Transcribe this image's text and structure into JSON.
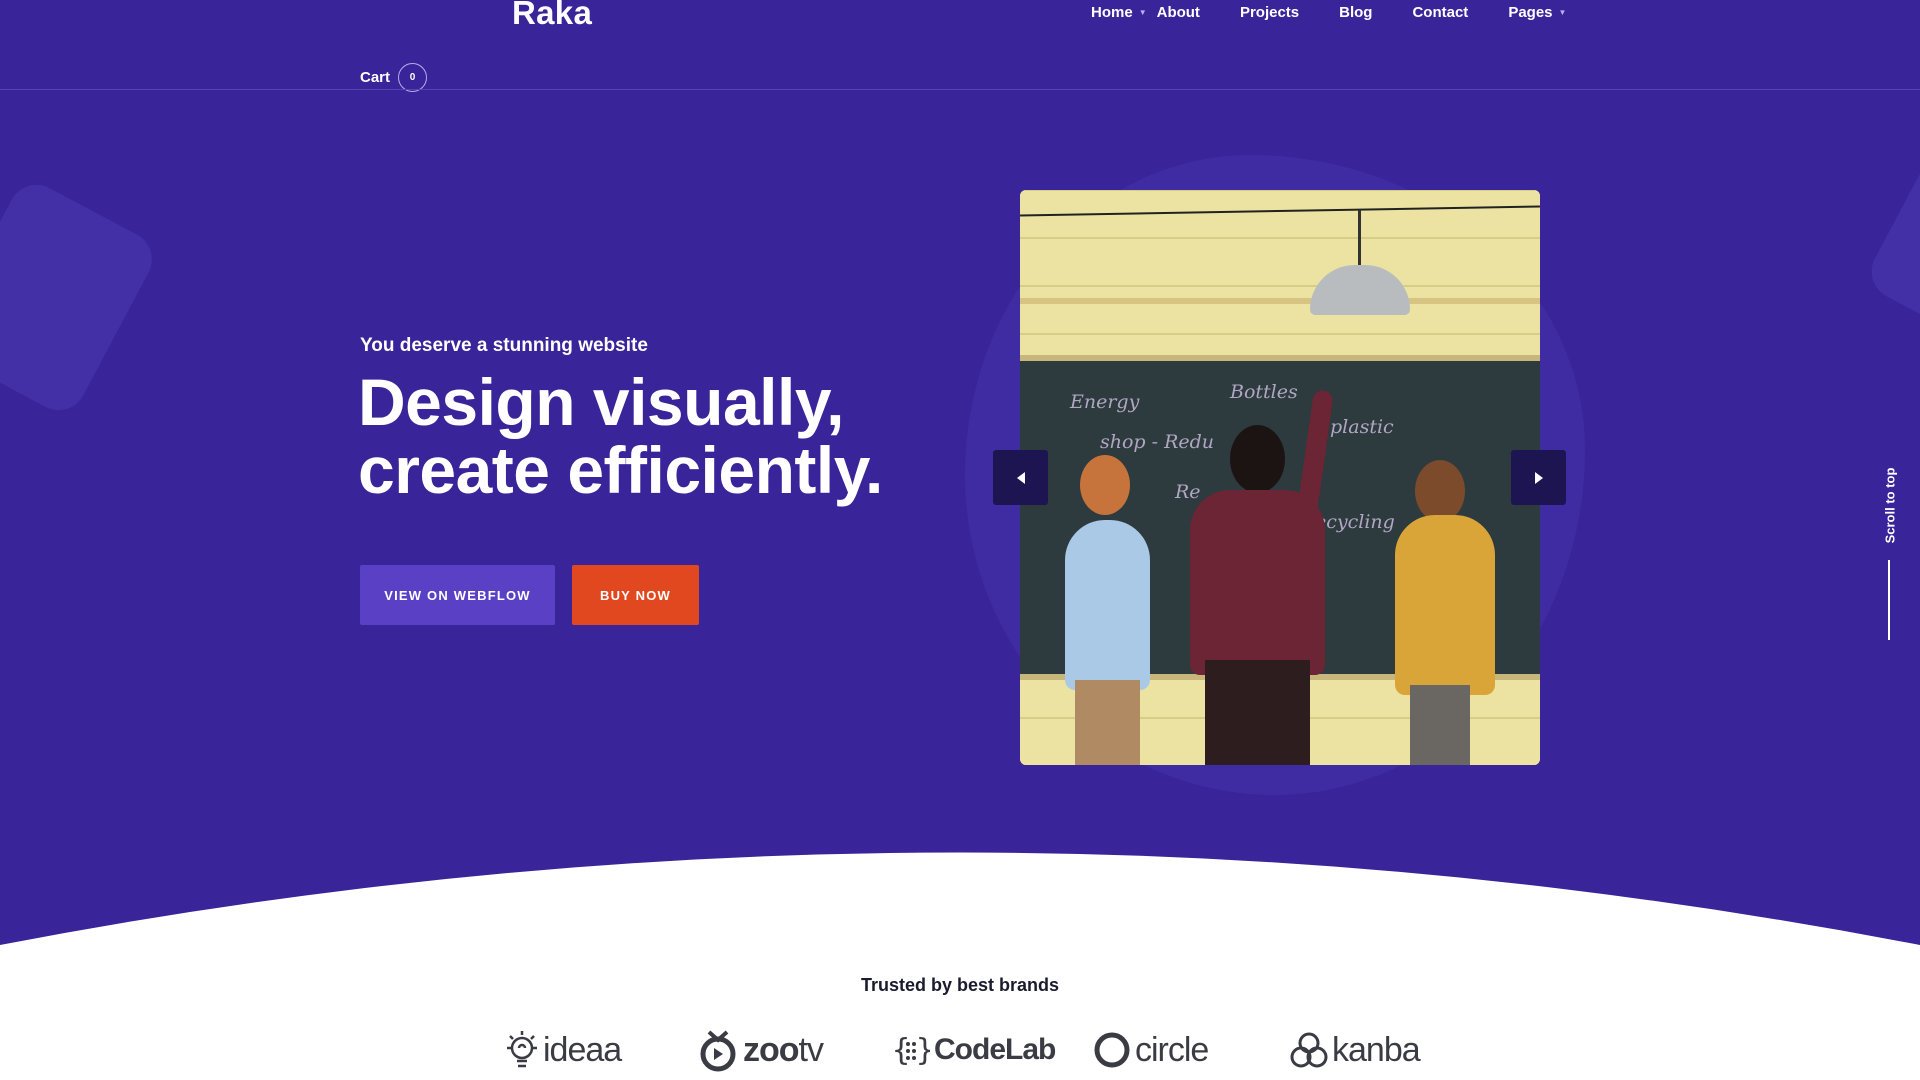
{
  "header": {
    "logo": "Raka",
    "nav": {
      "home": "Home",
      "about": "About",
      "projects": "Projects",
      "blog": "Blog",
      "contact": "Contact",
      "pages": "Pages"
    },
    "cart_label": "Cart",
    "cart_count": "0"
  },
  "hero": {
    "eyebrow": "You deserve a stunning website",
    "headline_line1": "Design visually,",
    "headline_line2": "create efficiently.",
    "btn_webflow": "VIEW ON WEBFLOW",
    "btn_buy": "BUY NOW"
  },
  "slider": {
    "chalk_words": [
      "Energy",
      "Bottles",
      "shop - Redu",
      "Re",
      "plastic",
      "ecycling"
    ]
  },
  "scroll_top": "Scroll to top",
  "brands": {
    "title": "Trusted by best brands",
    "items": [
      "ideaa",
      "zoo",
      "tv",
      "CodeLab",
      "circle",
      "kanba"
    ]
  },
  "colors": {
    "hero_bg": "#3a249a",
    "button_primary": "#5a40c4",
    "button_accent": "#e2481f",
    "slider_arrow": "#1d1551"
  }
}
